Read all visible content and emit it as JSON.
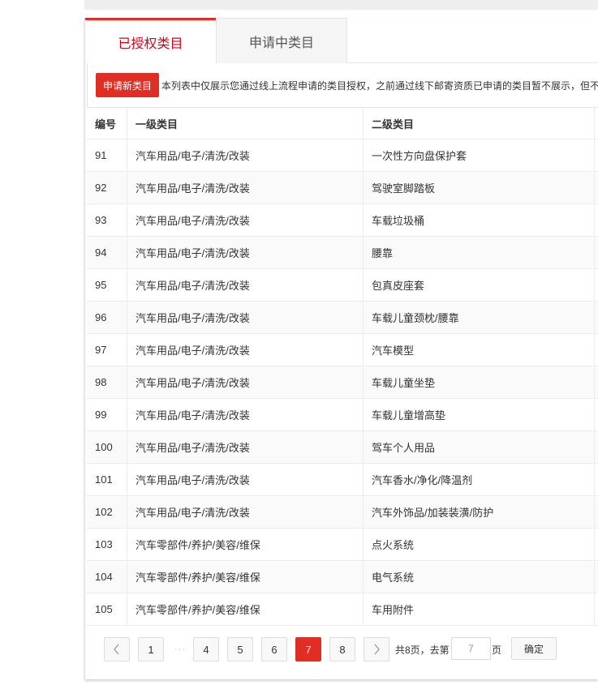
{
  "tabs": {
    "authorized": "已授权类目",
    "applying": "申请中类目"
  },
  "toolbar": {
    "apply_button": "申请新类目",
    "notice": "本列表中仅展示您通过线上流程申请的类目授权，之前通过线下邮寄资质已申请的类目暂不展示，但不"
  },
  "table": {
    "headers": [
      "编号",
      "一级类目",
      "二级类目"
    ],
    "rows": [
      {
        "id": "91",
        "level1": "汽车用品/电子/清洗/改装",
        "level2": "一次性方向盘保护套"
      },
      {
        "id": "92",
        "level1": "汽车用品/电子/清洗/改装",
        "level2": "驾驶室脚踏板"
      },
      {
        "id": "93",
        "level1": "汽车用品/电子/清洗/改装",
        "level2": "车载垃圾桶"
      },
      {
        "id": "94",
        "level1": "汽车用品/电子/清洗/改装",
        "level2": "腰靠"
      },
      {
        "id": "95",
        "level1": "汽车用品/电子/清洗/改装",
        "level2": "包真皮座套"
      },
      {
        "id": "96",
        "level1": "汽车用品/电子/清洗/改装",
        "level2": "车载儿童颈枕/腰靠"
      },
      {
        "id": "97",
        "level1": "汽车用品/电子/清洗/改装",
        "level2": "汽车模型"
      },
      {
        "id": "98",
        "level1": "汽车用品/电子/清洗/改装",
        "level2": "车载儿童坐垫"
      },
      {
        "id": "99",
        "level1": "汽车用品/电子/清洗/改装",
        "level2": "车载儿童增高垫"
      },
      {
        "id": "100",
        "level1": "汽车用品/电子/清洗/改装",
        "level2": "驾车个人用品"
      },
      {
        "id": "101",
        "level1": "汽车用品/电子/清洗/改装",
        "level2": "汽车香水/净化/降温剂"
      },
      {
        "id": "102",
        "level1": "汽车用品/电子/清洗/改装",
        "level2": "汽车外饰品/加装装潢/防护"
      },
      {
        "id": "103",
        "level1": "汽车零部件/养护/美容/维保",
        "level2": "点火系统"
      },
      {
        "id": "104",
        "level1": "汽车零部件/养护/美容/维保",
        "level2": "电气系统"
      },
      {
        "id": "105",
        "level1": "汽车零部件/养护/美容/维保",
        "level2": "车用附件"
      }
    ]
  },
  "pagination": {
    "prev_icon": "chevron-left-icon",
    "next_icon": "chevron-right-icon",
    "pages": [
      "1",
      "4",
      "5",
      "6",
      "7",
      "8"
    ],
    "ellipsis": "···",
    "current": "7",
    "total_text": "共8页，去第",
    "goto_value": "7",
    "page_unit": "页",
    "confirm": "确定"
  },
  "colors": {
    "accent": "#e02e24",
    "active_tab_text": "#d9001b"
  }
}
